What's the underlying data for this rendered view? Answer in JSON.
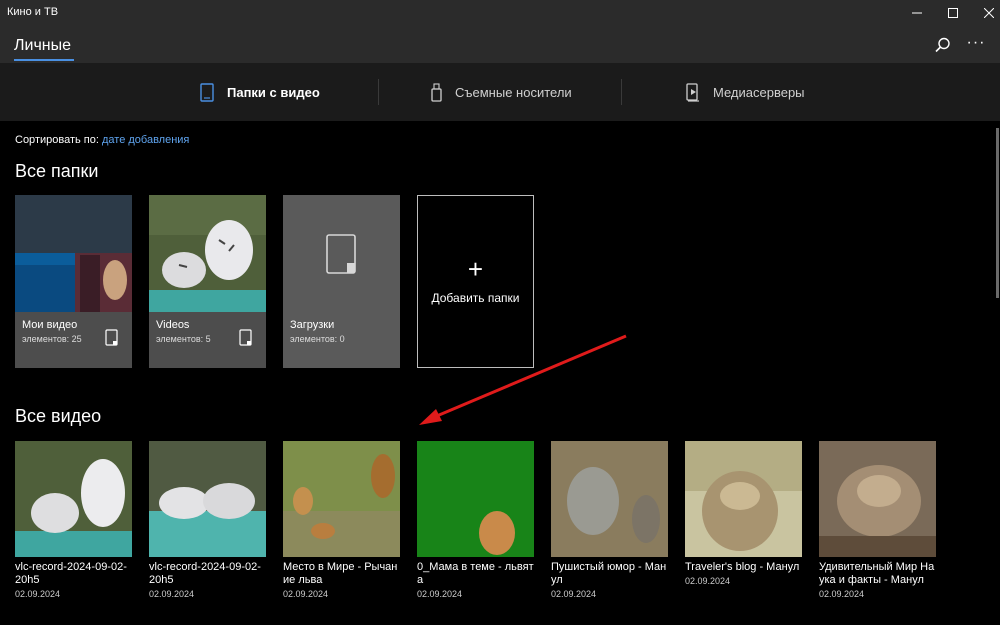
{
  "app": {
    "title": "Кино и ТВ"
  },
  "header": {
    "title": "Личные"
  },
  "tabs": [
    {
      "label": "Папки с видео",
      "icon": "folder-phone-icon",
      "active": true
    },
    {
      "label": "Съемные носители",
      "icon": "usb-drive-icon",
      "active": false
    },
    {
      "label": "Медиасерверы",
      "icon": "media-server-icon",
      "active": false
    }
  ],
  "sort": {
    "label": "Сортировать по:",
    "value": "дате добавления"
  },
  "sections": {
    "folders": "Все папки",
    "videos": "Все видео"
  },
  "folders": [
    {
      "name": "Мои видео",
      "count": "элементов: 25"
    },
    {
      "name": "Videos",
      "count": "элементов: 5"
    },
    {
      "name": "Загрузки",
      "count": "элементов: 0"
    }
  ],
  "add_folder": {
    "label": "Добавить папки",
    "icon": "plus-icon"
  },
  "videos": [
    {
      "title": "vlc-record-2024-09-02-20h5",
      "date": "02.09.2024"
    },
    {
      "title": "vlc-record-2024-09-02-20h5",
      "date": "02.09.2024"
    },
    {
      "title": "Место в Мире - Рычание льва",
      "date": "02.09.2024"
    },
    {
      "title": "0_Мама в теме - львята",
      "date": "02.09.2024"
    },
    {
      "title": "Пушистый юмор - Манул",
      "date": "02.09.2024"
    },
    {
      "title": "Traveler's blog - Манул",
      "date": "02.09.2024"
    },
    {
      "title": "Удивительный Мир Наука и факты - Манул",
      "date": "02.09.2024"
    }
  ],
  "colors": {
    "accent": "#4a90e2",
    "link": "#5fa4ef",
    "annotation_arrow": "#e01b1b"
  }
}
